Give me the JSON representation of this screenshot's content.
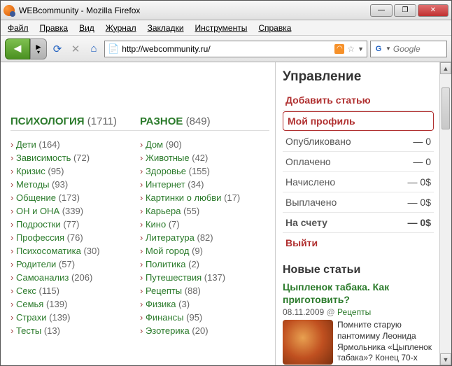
{
  "window": {
    "title": "WEBcommunity - Mozilla Firefox"
  },
  "menubar": [
    "Файл",
    "Правка",
    "Вид",
    "Журнал",
    "Закладки",
    "Инструменты",
    "Справка"
  ],
  "toolbar": {
    "url": "http://webcommunity.ru/",
    "search_placeholder": "Google",
    "search_prefix": "G"
  },
  "columns": [
    {
      "title": "ПСИХОЛОГИЯ",
      "count": "(1711)",
      "items": [
        {
          "name": "Дети",
          "count": "(164)"
        },
        {
          "name": "Зависимость",
          "count": "(72)"
        },
        {
          "name": "Кризис",
          "count": "(95)"
        },
        {
          "name": "Методы",
          "count": "(93)"
        },
        {
          "name": "Общение",
          "count": "(173)"
        },
        {
          "name": "ОН и ОНА",
          "count": "(339)"
        },
        {
          "name": "Подростки",
          "count": "(77)"
        },
        {
          "name": "Профессия",
          "count": "(76)"
        },
        {
          "name": "Психосоматика",
          "count": "(30)"
        },
        {
          "name": "Родители",
          "count": "(57)"
        },
        {
          "name": "Самоанализ",
          "count": "(206)"
        },
        {
          "name": "Секс",
          "count": "(115)"
        },
        {
          "name": "Семья",
          "count": "(139)"
        },
        {
          "name": "Страхи",
          "count": "(139)"
        },
        {
          "name": "Тесты",
          "count": "(13)"
        }
      ]
    },
    {
      "title": "РАЗНОЕ",
      "count": "(849)",
      "items": [
        {
          "name": "Дом",
          "count": "(90)"
        },
        {
          "name": "Животные",
          "count": "(42)"
        },
        {
          "name": "Здоровье",
          "count": "(155)"
        },
        {
          "name": "Интернет",
          "count": "(34)"
        },
        {
          "name": "Картинки о любви",
          "count": "(17)"
        },
        {
          "name": "Карьера",
          "count": "(55)"
        },
        {
          "name": "Кино",
          "count": "(7)"
        },
        {
          "name": "Литература",
          "count": "(82)"
        },
        {
          "name": "Мой город",
          "count": "(9)"
        },
        {
          "name": "Политика",
          "count": "(2)"
        },
        {
          "name": "Путешествия",
          "count": "(137)"
        },
        {
          "name": "Рецепты",
          "count": "(88)"
        },
        {
          "name": "Физика",
          "count": "(3)"
        },
        {
          "name": "Финансы",
          "count": "(95)"
        },
        {
          "name": "Эзотерика",
          "count": "(20)"
        }
      ]
    }
  ],
  "sidebar": {
    "heading": "Управление",
    "add_article": "Добавить статью",
    "my_profile": "Мой профиль",
    "stats": [
      {
        "label": "Опубликовано",
        "value": "— 0"
      },
      {
        "label": "Оплачено",
        "value": "— 0"
      },
      {
        "label": "Начислено",
        "value": "— 0$"
      },
      {
        "label": "Выплачено",
        "value": "— 0$"
      },
      {
        "label": "На счету",
        "value": "— 0$",
        "bold": true
      }
    ],
    "logout": "Выйти",
    "new_articles_heading": "Новые статьи",
    "article": {
      "title": "Цыпленок табака. Как приготовить?",
      "date": "08.11.2009",
      "tag_sep": "@",
      "tag": "Рецепты",
      "excerpt": "Помните старую пантомиму Леонида Ярмольника «Цыпленок табака»? Конец 70-х"
    }
  }
}
